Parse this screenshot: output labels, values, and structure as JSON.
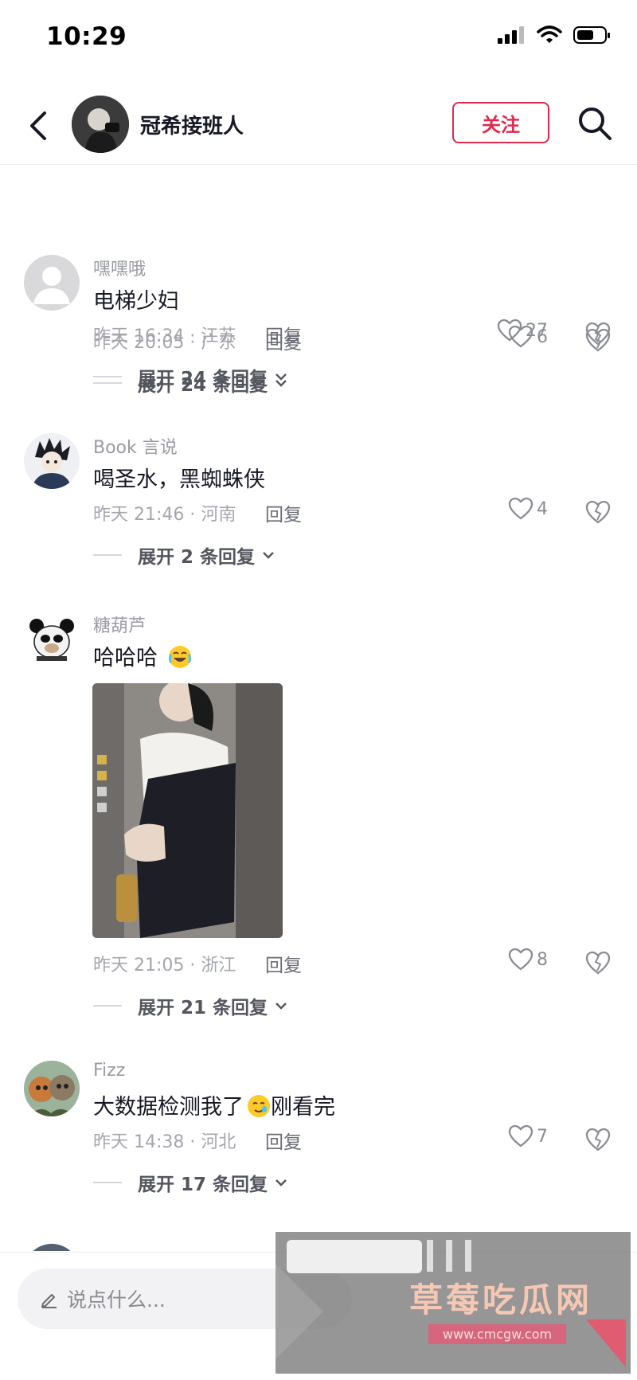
{
  "status": {
    "time": "10:29"
  },
  "header": {
    "name": "冠希接班人",
    "follow_label": "关注"
  },
  "comments": [
    {
      "meta": "昨天 20:05 · 广东",
      "reply": "回复",
      "likes": "6",
      "expand": "展开 24 条回复"
    },
    {
      "user": "嘿嘿哦",
      "text": "电梯少妇",
      "meta": "昨天 16:34 · 江苏",
      "reply": "回复",
      "likes": "27",
      "expand": "展开 24 条回复"
    },
    {
      "user": "Book 言说",
      "text": "喝圣水，黑蜘蛛侠",
      "meta": "昨天 21:46 · 河南",
      "reply": "回复",
      "likes": "4",
      "expand": "展开 2 条回复"
    },
    {
      "user": "糖葫芦",
      "text": "哈哈哈",
      "emoji": "laughing-crying-emoji",
      "meta": "昨天 21:05 · 浙江",
      "reply": "回复",
      "likes": "8",
      "expand": "展开 21 条回复"
    },
    {
      "user": "Fizz",
      "text_a": "大数据检测我了",
      "emoji": "crying-smile-emoji",
      "text_b": "刚看完",
      "meta": "昨天 14:38 · 河北",
      "reply": "回复",
      "likes": "7",
      "expand": "展开 17 条回复"
    }
  ],
  "input": {
    "placeholder": "说点什么..."
  },
  "watermark": {
    "title": "草莓吃瓜网",
    "url": "www.cmcgw.com"
  },
  "colors": {
    "accent": "#e0294f",
    "text": "#161823",
    "muted": "#a4a6ad"
  }
}
